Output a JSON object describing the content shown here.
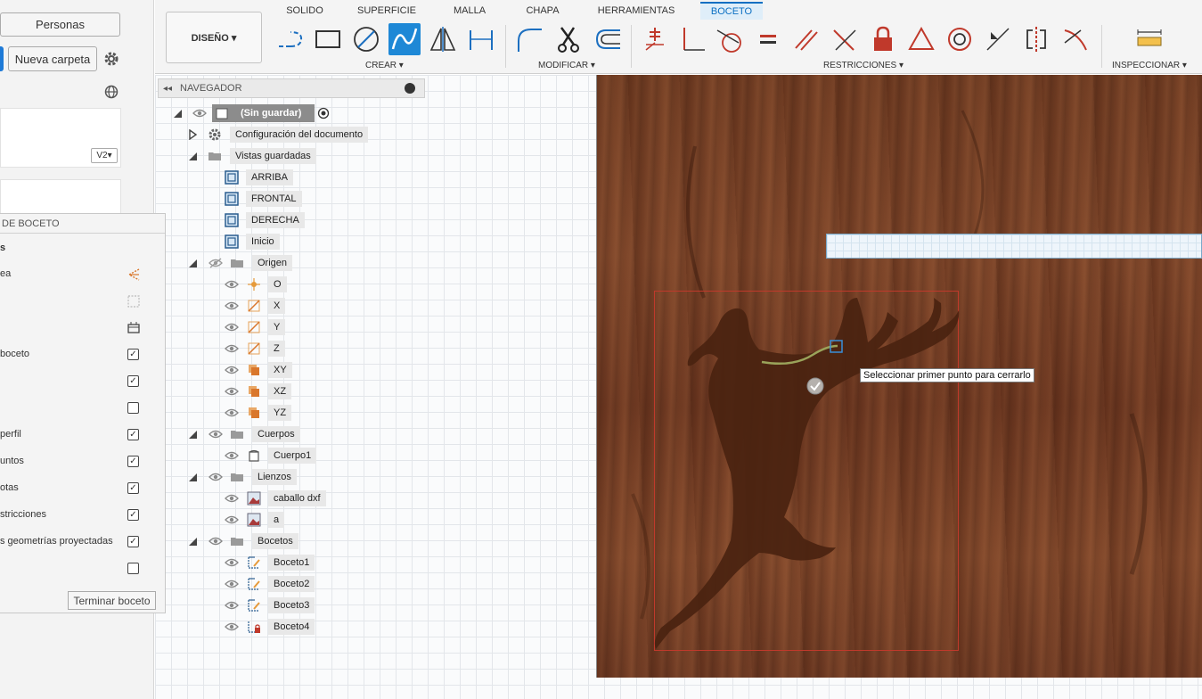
{
  "left_panel": {
    "people_button": "Personas",
    "new_folder_button": "Nueva carpeta",
    "settings_icon": "gear-icon",
    "globe_icon": "globe-icon",
    "version_badge": "V2▾"
  },
  "sketch_palette": {
    "header": "DE BOCETO",
    "section": "s",
    "rows": [
      {
        "label": "ea",
        "control": "icon"
      },
      {
        "label": "",
        "control": "icon"
      },
      {
        "label": "",
        "control": "icon"
      },
      {
        "label": "boceto",
        "control": "checked"
      },
      {
        "label": "",
        "control": "checked"
      },
      {
        "label": "",
        "control": "unchecked"
      },
      {
        "label": "perfil",
        "control": "checked"
      },
      {
        "label": "untos",
        "control": "checked"
      },
      {
        "label": "otas",
        "control": "checked"
      },
      {
        "label": "stricciones",
        "control": "checked"
      },
      {
        "label": "s geometrías proyectadas",
        "control": "checked"
      },
      {
        "label": "",
        "control": "unchecked"
      }
    ],
    "finish_button": "Terminar boceto"
  },
  "toolbar": {
    "tabs": [
      "SOLIDO",
      "SUPERFICIE",
      "MALLA",
      "CHAPA",
      "HERRAMIENTAS",
      "BOCETO"
    ],
    "active_tab": "BOCETO",
    "workspace_button": "DISEÑO ▾",
    "groups": {
      "create": "CREAR ▾",
      "modify": "MODIFICAR ▾",
      "constraints": "RESTRICCIONES ▾",
      "inspect": "INSPECCIONAR ▾"
    },
    "accent": "#1e88d6"
  },
  "navigator": {
    "title": "NAVEGADOR",
    "root": "(Sin guardar)",
    "items": [
      {
        "label": "Configuración del documento",
        "icon": "gear-icon"
      },
      {
        "label": "Vistas guardadas",
        "icon": "folder-icon"
      },
      {
        "label": "ARRIBA",
        "icon": "view-icon"
      },
      {
        "label": "FRONTAL",
        "icon": "view-icon"
      },
      {
        "label": "DERECHA",
        "icon": "view-icon"
      },
      {
        "label": "Inicio",
        "icon": "view-icon"
      },
      {
        "label": "Origen",
        "icon": "folder-icon"
      },
      {
        "label": "O",
        "icon": "origin-point-icon"
      },
      {
        "label": "X",
        "icon": "axis-icon"
      },
      {
        "label": "Y",
        "icon": "axis-icon"
      },
      {
        "label": "Z",
        "icon": "axis-icon"
      },
      {
        "label": "XY",
        "icon": "plane-icon"
      },
      {
        "label": "XZ",
        "icon": "plane-icon"
      },
      {
        "label": "YZ",
        "icon": "plane-icon"
      },
      {
        "label": "Cuerpos",
        "icon": "folder-icon"
      },
      {
        "label": "Cuerpo1",
        "icon": "body-icon"
      },
      {
        "label": "Lienzos",
        "icon": "folder-icon"
      },
      {
        "label": "caballo dxf",
        "icon": "canvas-image-icon"
      },
      {
        "label": "a",
        "icon": "canvas-image-icon"
      },
      {
        "label": "Bocetos",
        "icon": "folder-icon"
      },
      {
        "label": "Boceto1",
        "icon": "sketch-icon"
      },
      {
        "label": "Boceto2",
        "icon": "sketch-icon"
      },
      {
        "label": "Boceto3",
        "icon": "sketch-icon"
      },
      {
        "label": "Boceto4",
        "icon": "sketch-edit-icon"
      }
    ]
  },
  "viewport": {
    "tooltip": "Seleccionar primer punto para cerrarlo"
  }
}
